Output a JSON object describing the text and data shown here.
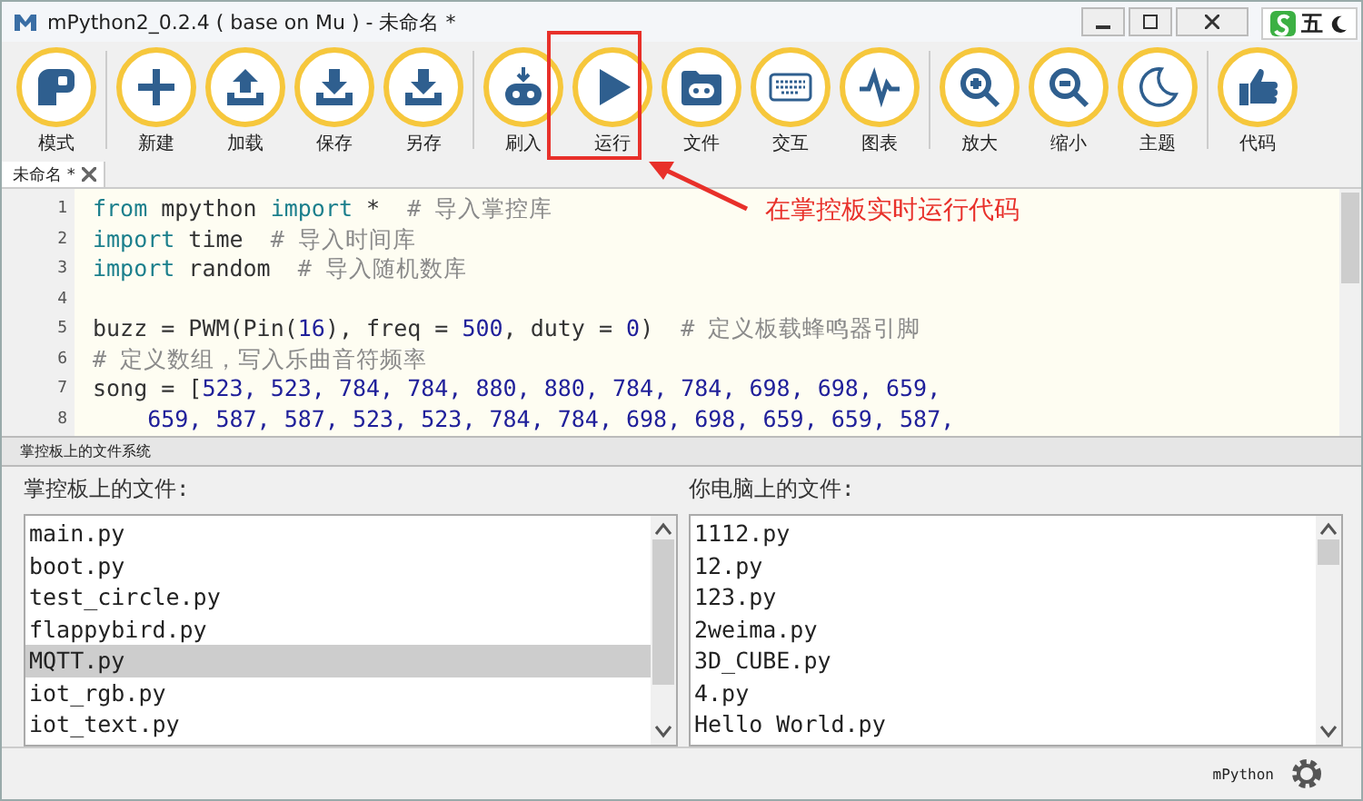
{
  "window": {
    "title": "mPython2_0.2.4 ( base on Mu ) - 未命名 *"
  },
  "ime_bar": {
    "mode": "五"
  },
  "toolbar": [
    {
      "label": "模式"
    },
    {
      "label": "新建"
    },
    {
      "label": "加载"
    },
    {
      "label": "保存"
    },
    {
      "label": "另存"
    },
    {
      "label": "刷入"
    },
    {
      "label": "运行"
    },
    {
      "label": "文件"
    },
    {
      "label": "交互"
    },
    {
      "label": "图表"
    },
    {
      "label": "放大"
    },
    {
      "label": "缩小"
    },
    {
      "label": "主题"
    },
    {
      "label": "代码"
    }
  ],
  "annotation": {
    "text": "在掌控板实时运行代码"
  },
  "tabs": [
    {
      "label": "未命名 *",
      "selected": true
    }
  ],
  "editor": {
    "lines": [
      {
        "number": "1",
        "segments": [
          {
            "kind": "kw",
            "text": "from"
          },
          {
            "kind": "plain",
            "text": " mpython "
          },
          {
            "kind": "kw",
            "text": "import"
          },
          {
            "kind": "plain",
            "text": " *  "
          },
          {
            "kind": "comment",
            "text": "# 导入掌控库"
          }
        ]
      },
      {
        "number": "2",
        "segments": [
          {
            "kind": "kw",
            "text": "import"
          },
          {
            "kind": "plain",
            "text": " time  "
          },
          {
            "kind": "comment",
            "text": "# 导入时间库"
          }
        ]
      },
      {
        "number": "3",
        "segments": [
          {
            "kind": "kw",
            "text": "import"
          },
          {
            "kind": "plain",
            "text": " random  "
          },
          {
            "kind": "comment",
            "text": "# 导入随机数库"
          }
        ]
      },
      {
        "number": "4"
      },
      {
        "number": "5",
        "segments": [
          {
            "kind": "plain",
            "text": "buzz = PWM(Pin("
          },
          {
            "kind": "num",
            "text": "16"
          },
          {
            "kind": "plain",
            "text": "), freq = "
          },
          {
            "kind": "num",
            "text": "500"
          },
          {
            "kind": "plain",
            "text": ", duty = "
          },
          {
            "kind": "num",
            "text": "0"
          },
          {
            "kind": "plain",
            "text": ")  "
          },
          {
            "kind": "comment",
            "text": "# 定义板载蜂鸣器引脚"
          }
        ]
      },
      {
        "number": "6",
        "segments": [
          {
            "kind": "comment",
            "text": "# 定义数组，写入乐曲音符频率"
          }
        ]
      },
      {
        "number": "7",
        "segments": [
          {
            "kind": "plain",
            "text": "song = ["
          },
          {
            "kind": "num",
            "text": "523, 523, 784, 784, 880, 880, 784, 784, 698, 698, 659,"
          }
        ]
      },
      {
        "number": "8",
        "segments": [
          {
            "kind": "num",
            "text": "    659, 587, 587, 523, 523, 784, 784, 698, 698, 659, 659, 587,"
          }
        ]
      }
    ]
  },
  "file_pane": {
    "title": "掌控板上的文件系统",
    "board": {
      "heading": "掌控板上的文件:",
      "files": [
        {
          "name": "main.py",
          "selected": false
        },
        {
          "name": "boot.py",
          "selected": false
        },
        {
          "name": "test_circle.py",
          "selected": false
        },
        {
          "name": "flappybird.py",
          "selected": false
        },
        {
          "name": "MQTT.py",
          "selected": true
        },
        {
          "name": "iot_rgb.py",
          "selected": false
        },
        {
          "name": "iot_text.py",
          "selected": false
        }
      ]
    },
    "computer": {
      "heading": "你电脑上的文件:",
      "files": [
        {
          "name": "1112.py",
          "selected": false
        },
        {
          "name": "12.py",
          "selected": false
        },
        {
          "name": "123.py",
          "selected": false
        },
        {
          "name": "2weima.py",
          "selected": false
        },
        {
          "name": "3D_CUBE.py",
          "selected": false
        },
        {
          "name": "4.py",
          "selected": false
        },
        {
          "name": "Hello World.py",
          "selected": false
        }
      ]
    }
  },
  "status_bar": {
    "mode": "mPython"
  }
}
